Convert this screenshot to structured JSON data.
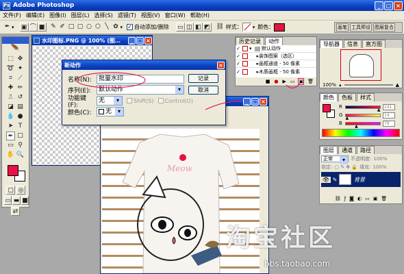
{
  "app": {
    "title": "Adobe Photoshop"
  },
  "menu": [
    "文件(F)",
    "编辑(E)",
    "图像(I)",
    "图层(L)",
    "选择(S)",
    "滤镜(T)",
    "视图(V)",
    "窗口(W)",
    "帮助(H)"
  ],
  "options_bar": {
    "auto_add_remove": "自动添加/删除",
    "style_label": "样式：",
    "color_label": "颜色：",
    "color_value": "#e0163f"
  },
  "palette_well": [
    "画笔",
    "工具预设",
    "图层复合"
  ],
  "doc_window": {
    "title": "水印图标.PNG @ 100% (图…"
  },
  "dialog": {
    "title": "新动作",
    "name_label": "名称(N):",
    "name_value": "批量水印",
    "set_label": "序列(E):",
    "set_value": "默认动作",
    "fkey_label": "功能键(F):",
    "fkey_value": "无",
    "shift_label": "Shift(S)",
    "control_label": "Control(O)",
    "color_label": "颜色(C):",
    "color_value": "无",
    "record_button": "记录",
    "cancel_button": "取消"
  },
  "actions_panel": {
    "tabs": [
      "历史记录",
      "动作"
    ],
    "items": [
      "默认动作",
      "装饰图案（选区）",
      "画框通道 - 50 像素",
      "木质画框 - 50 像素"
    ]
  },
  "navigator_panel": {
    "tabs": [
      "导航器",
      "信息",
      "直方图"
    ],
    "zoom": "100%"
  },
  "color_panel": {
    "tabs": [
      "颜色",
      "色板",
      "样式"
    ],
    "channels": [
      {
        "label": "R",
        "value": "241",
        "fraction": 0.94
      },
      {
        "label": "G",
        "value": "14",
        "fraction": 0.05
      },
      {
        "label": "B",
        "value": "78",
        "fraction": 0.31
      }
    ],
    "foreground": "#f10e4e"
  },
  "layers_panel": {
    "tabs": [
      "图层",
      "通道",
      "路径"
    ],
    "blend_mode": "正常",
    "opacity_label": "不透明度:",
    "opacity_value": "100%",
    "lock_label": "锁定:",
    "fill_label": "填充:",
    "fill_value": "100%",
    "layer_name": "背景"
  },
  "tool_colors": {
    "foreground": "#e8114a",
    "background": "#ffffff"
  },
  "watermark": {
    "text": "淘宝社区",
    "url": "bbs.taobao.com"
  }
}
